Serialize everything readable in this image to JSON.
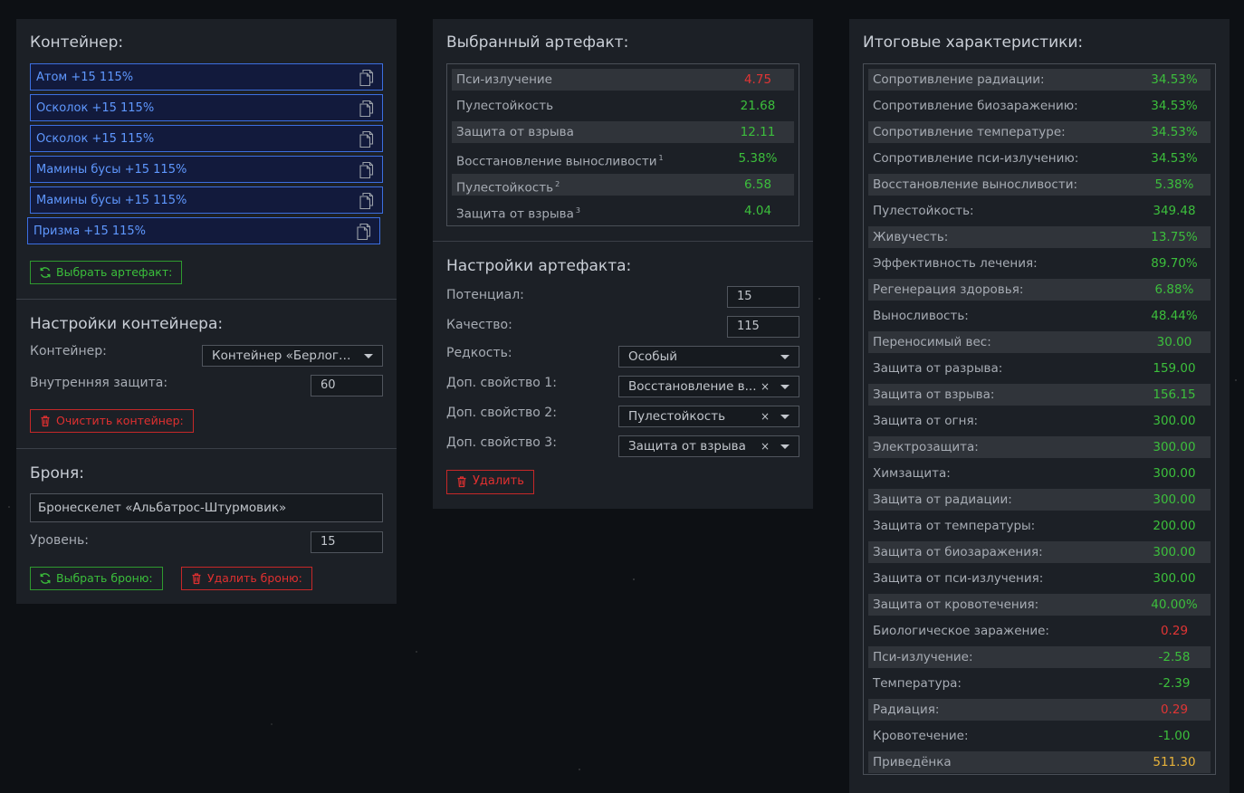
{
  "container_panel": {
    "title": "Контейнер:",
    "artifacts": [
      {
        "label": "Атом +15 115%"
      },
      {
        "label": "Осколок +15 115%"
      },
      {
        "label": "Осколок +15 115%"
      },
      {
        "label": "Мамины бусы +15 115%"
      },
      {
        "label": "Мамины бусы +15 115%"
      },
      {
        "label": "Призма +15 115%"
      }
    ],
    "select_artifact_label": "Выбрать артефакт:",
    "settings_title": "Настройки контейнера:",
    "container_label": "Контейнер:",
    "container_value": "Контейнер «Берлога...",
    "inner_protection_label": "Внутренняя защита:",
    "inner_protection_value": "60",
    "clear_label": "Очистить контейнер:",
    "armor_title": "Броня:",
    "armor_value": "Бронескелет «Альбатрос-Штурмовик»",
    "level_label": "Уровень:",
    "level_value": "15",
    "select_armor_label": "Выбрать броню:",
    "delete_armor_label": "Удалить броню:"
  },
  "artifact_panel": {
    "title": "Выбранный артефакт:",
    "stats": [
      {
        "name": "Пси-излучение",
        "sup": "",
        "value": "4.75",
        "color": "#e03535"
      },
      {
        "name": "Пулестойкость",
        "sup": "",
        "value": "21.68",
        "color": "#3cbf3c"
      },
      {
        "name": "Защита от взрыва",
        "sup": "",
        "value": "12.11",
        "color": "#3cbf3c"
      },
      {
        "name": "Восстановление выносливости",
        "sup": "1",
        "value": "5.38%",
        "color": "#3cbf3c"
      },
      {
        "name": "Пулестойкость",
        "sup": "2",
        "value": "6.58",
        "color": "#3cbf3c"
      },
      {
        "name": "Защита от взрыва",
        "sup": "3",
        "value": "4.04",
        "color": "#3cbf3c"
      }
    ],
    "settings_title": "Настройки артефакта:",
    "potential_label": "Потенциал:",
    "potential_value": "15",
    "quality_label": "Качество:",
    "quality_value": "115",
    "rarity_label": "Редкость:",
    "rarity_value": "Особый",
    "extra1_label": "Доп. свойство 1:",
    "extra1_value": "Восстановление в...",
    "extra2_label": "Доп. свойство 2:",
    "extra2_value": "Пулестойкость",
    "extra3_label": "Доп. свойство 3:",
    "extra3_value": "Защита от взрыва",
    "clear_mark": "×",
    "delete_label": "Удалить"
  },
  "totals_panel": {
    "title": "Итоговые характеристики:",
    "stats": [
      {
        "name": "Сопротивление радиации:",
        "value": "34.53%",
        "color": "#3cbf3c"
      },
      {
        "name": "Сопротивление биозаражению:",
        "value": "34.53%",
        "color": "#3cbf3c"
      },
      {
        "name": "Сопротивление температуре:",
        "value": "34.53%",
        "color": "#3cbf3c"
      },
      {
        "name": "Сопротивление пси-излучению:",
        "value": "34.53%",
        "color": "#3cbf3c"
      },
      {
        "name": "Восстановление выносливости:",
        "value": "5.38%",
        "color": "#3cbf3c"
      },
      {
        "name": "Пулестойкость:",
        "value": "349.48",
        "color": "#3cbf3c"
      },
      {
        "name": "Живучесть:",
        "value": "13.75%",
        "color": "#3cbf3c"
      },
      {
        "name": "Эффективность лечения:",
        "value": "89.70%",
        "color": "#3cbf3c"
      },
      {
        "name": "Регенерация здоровья:",
        "value": "6.88%",
        "color": "#3cbf3c"
      },
      {
        "name": "Выносливость:",
        "value": "48.44%",
        "color": "#3cbf3c"
      },
      {
        "name": "Переносимый вес:",
        "value": "30.00",
        "color": "#3cbf3c"
      },
      {
        "name": "Защита от разрыва:",
        "value": "159.00",
        "color": "#3cbf3c"
      },
      {
        "name": "Защита от взрыва:",
        "value": "156.15",
        "color": "#3cbf3c"
      },
      {
        "name": "Защита от огня:",
        "value": "300.00",
        "color": "#3cbf3c"
      },
      {
        "name": "Электрозащита:",
        "value": "300.00",
        "color": "#3cbf3c"
      },
      {
        "name": "Химзащита:",
        "value": "300.00",
        "color": "#3cbf3c"
      },
      {
        "name": "Защита от радиации:",
        "value": "300.00",
        "color": "#3cbf3c"
      },
      {
        "name": "Защита от температуры:",
        "value": "200.00",
        "color": "#3cbf3c"
      },
      {
        "name": "Защита от биозаражения:",
        "value": "300.00",
        "color": "#3cbf3c"
      },
      {
        "name": "Защита от пси-излучения:",
        "value": "300.00",
        "color": "#3cbf3c"
      },
      {
        "name": "Защита от кровотечения:",
        "value": "40.00%",
        "color": "#3cbf3c"
      },
      {
        "name": "Биологическое заражение:",
        "value": "0.29",
        "color": "#e03535"
      },
      {
        "name": "Пси-излучение:",
        "value": "-2.58",
        "color": "#3cbf3c"
      },
      {
        "name": "Температура:",
        "value": "-2.39",
        "color": "#3cbf3c"
      },
      {
        "name": "Радиация:",
        "value": "0.29",
        "color": "#e03535"
      },
      {
        "name": "Кровотечение:",
        "value": "-1.00",
        "color": "#3cbf3c"
      },
      {
        "name": "Приведёнка",
        "value": "511.30",
        "color": "#e8b33a"
      }
    ]
  }
}
